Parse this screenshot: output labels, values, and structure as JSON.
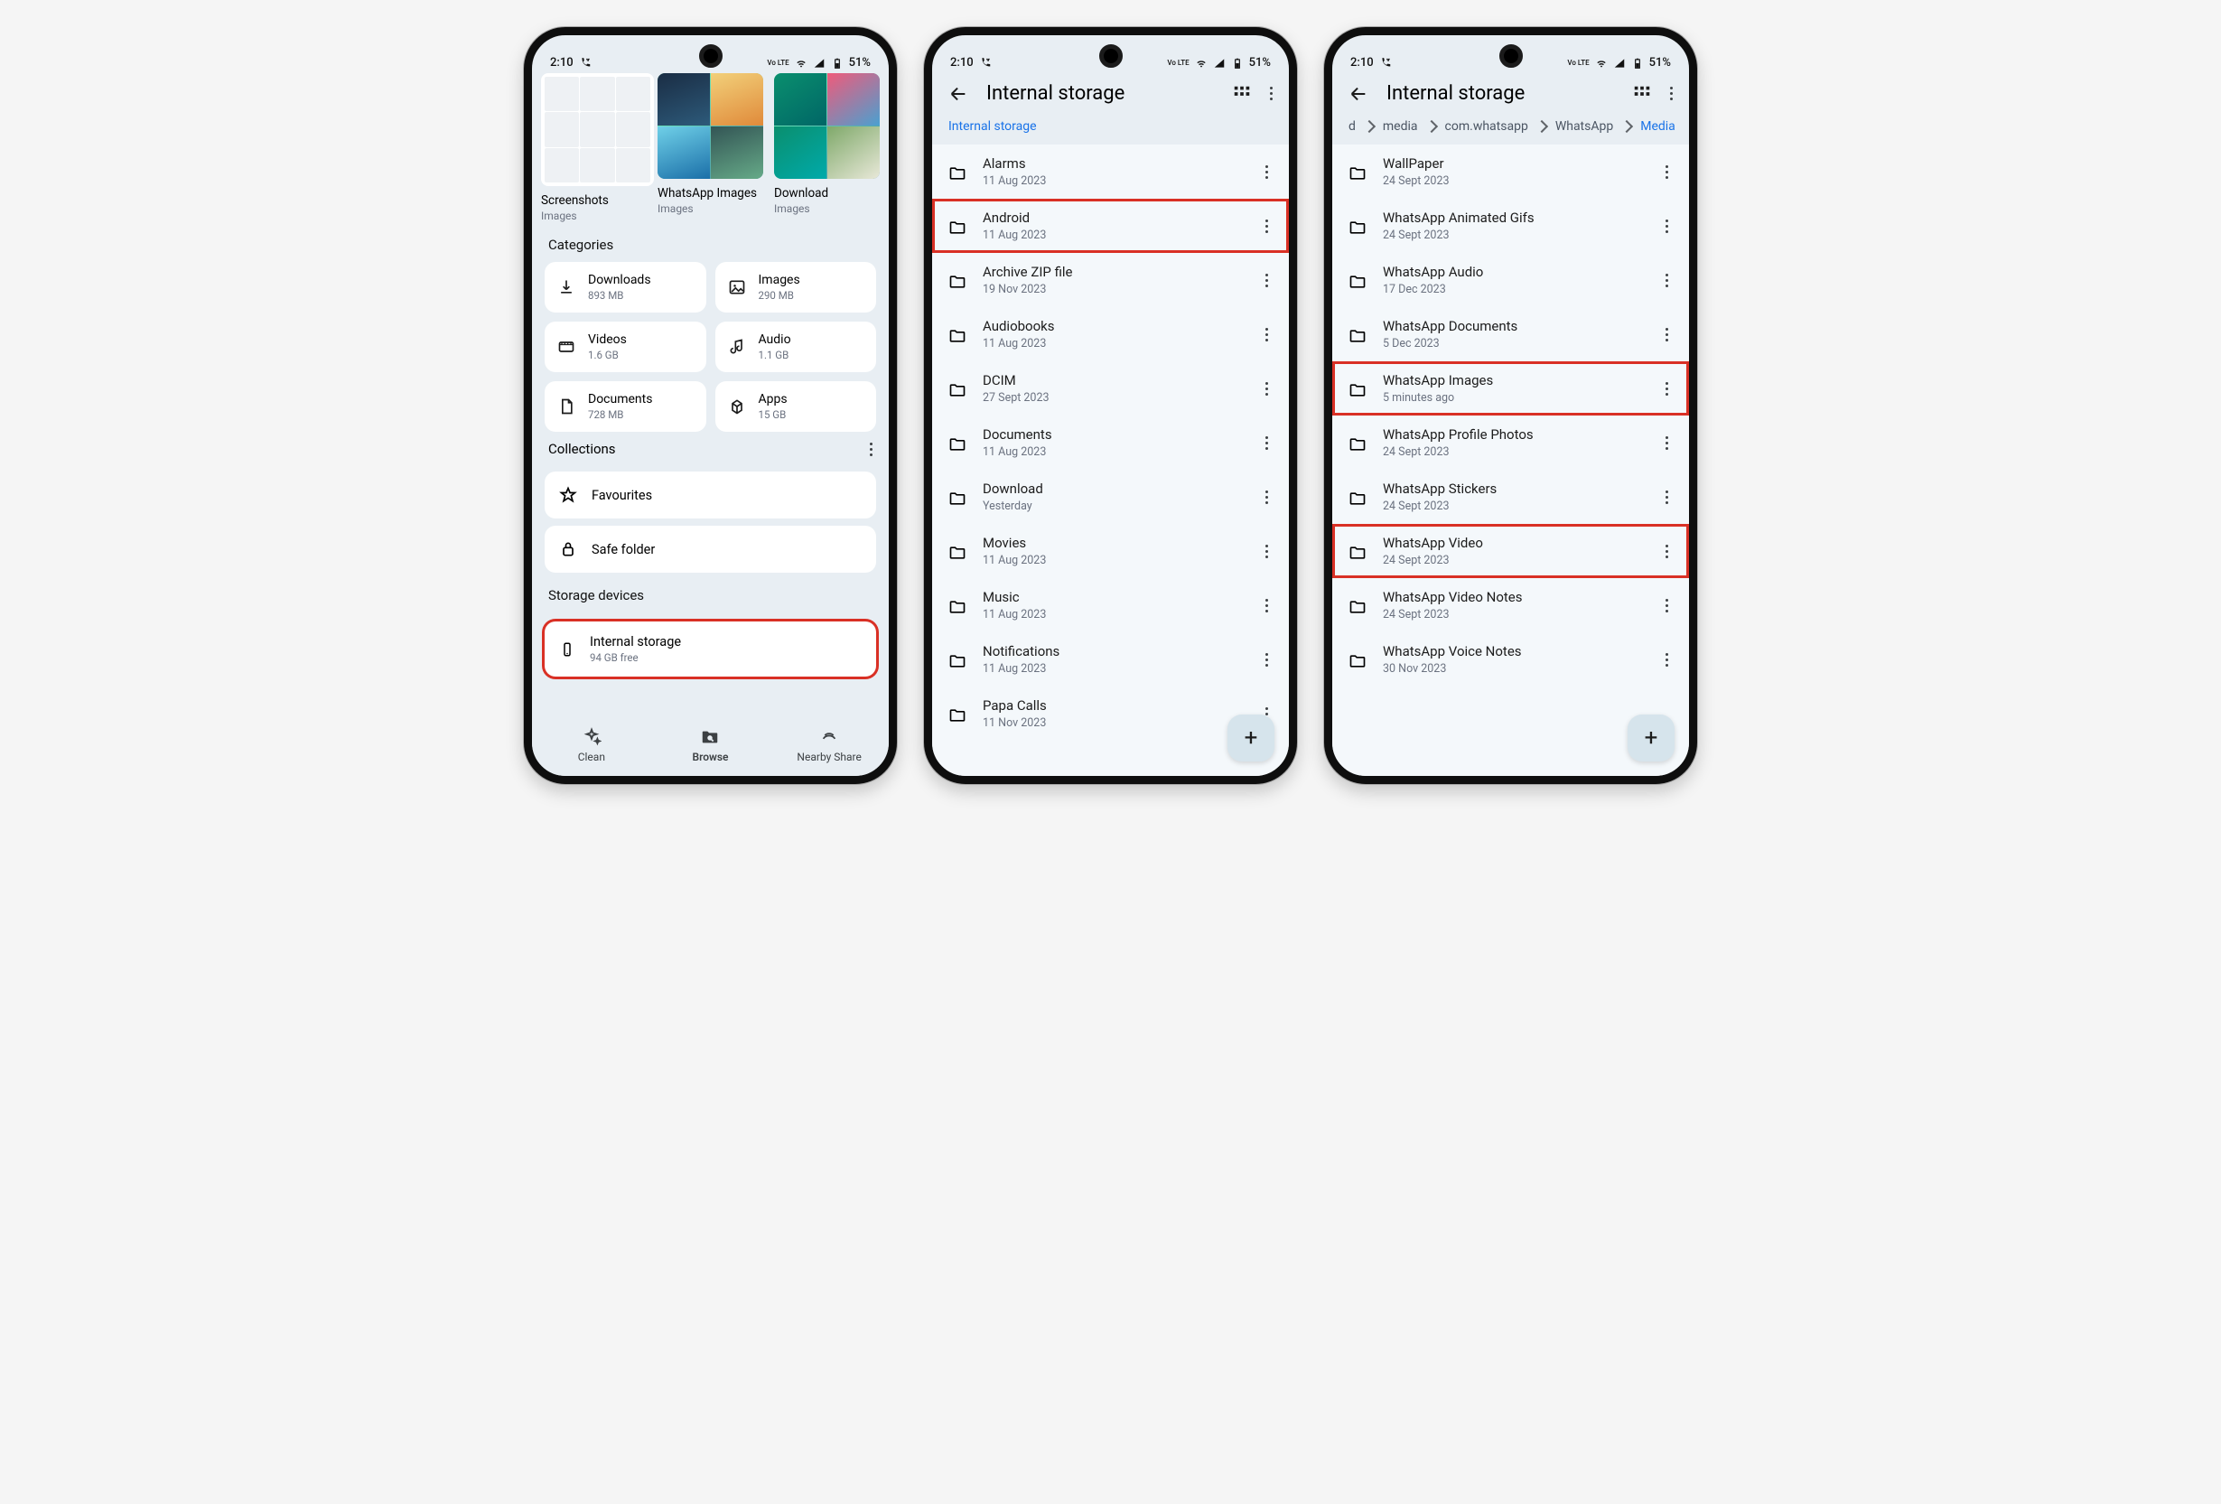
{
  "status": {
    "time": "2:10",
    "battery": "51%",
    "net_label": "Vo LTE"
  },
  "screen1": {
    "albums": [
      {
        "label": "Screenshots",
        "sublabel": "Images"
      },
      {
        "label": "WhatsApp Images",
        "sublabel": "Images"
      },
      {
        "label": "Download",
        "sublabel": "Images"
      }
    ],
    "categories_title": "Categories",
    "categories": [
      {
        "name": "Downloads",
        "sub": "893 MB",
        "icon": "download"
      },
      {
        "name": "Images",
        "sub": "290 MB",
        "icon": "image"
      },
      {
        "name": "Videos",
        "sub": "1.6 GB",
        "icon": "video"
      },
      {
        "name": "Audio",
        "sub": "1.1 GB",
        "icon": "audio"
      },
      {
        "name": "Documents",
        "sub": "728 MB",
        "icon": "doc"
      },
      {
        "name": "Apps",
        "sub": "15 GB",
        "icon": "apps"
      }
    ],
    "collections_title": "Collections",
    "collections": [
      {
        "name": "Favourites",
        "icon": "star"
      },
      {
        "name": "Safe folder",
        "icon": "lock"
      }
    ],
    "storage_title": "Storage devices",
    "storage": {
      "name": "Internal storage",
      "sub": "94 GB free"
    },
    "bottom_nav": [
      {
        "label": "Clean",
        "icon": "sparkle"
      },
      {
        "label": "Browse",
        "icon": "folder-search",
        "active": true
      },
      {
        "label": "Nearby Share",
        "icon": "share"
      }
    ]
  },
  "screen2": {
    "title": "Internal storage",
    "breadcrumb": [
      "Internal storage"
    ],
    "folders": [
      {
        "name": "Alarms",
        "meta": "11 Aug 2023"
      },
      {
        "name": "Android",
        "meta": "11 Aug 2023",
        "highlight": true
      },
      {
        "name": "Archive ZIP file",
        "meta": "19 Nov 2023"
      },
      {
        "name": "Audiobooks",
        "meta": "11 Aug 2023"
      },
      {
        "name": "DCIM",
        "meta": "27 Sept 2023"
      },
      {
        "name": "Documents",
        "meta": "11 Aug 2023"
      },
      {
        "name": "Download",
        "meta": "Yesterday"
      },
      {
        "name": "Movies",
        "meta": "11 Aug 2023"
      },
      {
        "name": "Music",
        "meta": "11 Aug 2023"
      },
      {
        "name": "Notifications",
        "meta": "11 Aug 2023"
      },
      {
        "name": "Papa Calls",
        "meta": "11 Nov 2023"
      }
    ]
  },
  "screen3": {
    "title": "Internal storage",
    "breadcrumb_prefix": "d",
    "breadcrumb": [
      "media",
      "com.whatsapp",
      "WhatsApp",
      "Media"
    ],
    "folders": [
      {
        "name": "WallPaper",
        "meta": "24 Sept 2023"
      },
      {
        "name": "WhatsApp Animated Gifs",
        "meta": "24 Sept 2023"
      },
      {
        "name": "WhatsApp Audio",
        "meta": "17 Dec 2023"
      },
      {
        "name": "WhatsApp Documents",
        "meta": "5 Dec 2023"
      },
      {
        "name": "WhatsApp Images",
        "meta": "5 minutes ago",
        "highlight": true
      },
      {
        "name": "WhatsApp Profile Photos",
        "meta": "24 Sept 2023"
      },
      {
        "name": "WhatsApp Stickers",
        "meta": "24 Sept 2023"
      },
      {
        "name": "WhatsApp Video",
        "meta": "24 Sept 2023",
        "highlight": true
      },
      {
        "name": "WhatsApp Video Notes",
        "meta": "24 Sept 2023"
      },
      {
        "name": "WhatsApp Voice Notes",
        "meta": "30 Nov 2023"
      }
    ]
  }
}
